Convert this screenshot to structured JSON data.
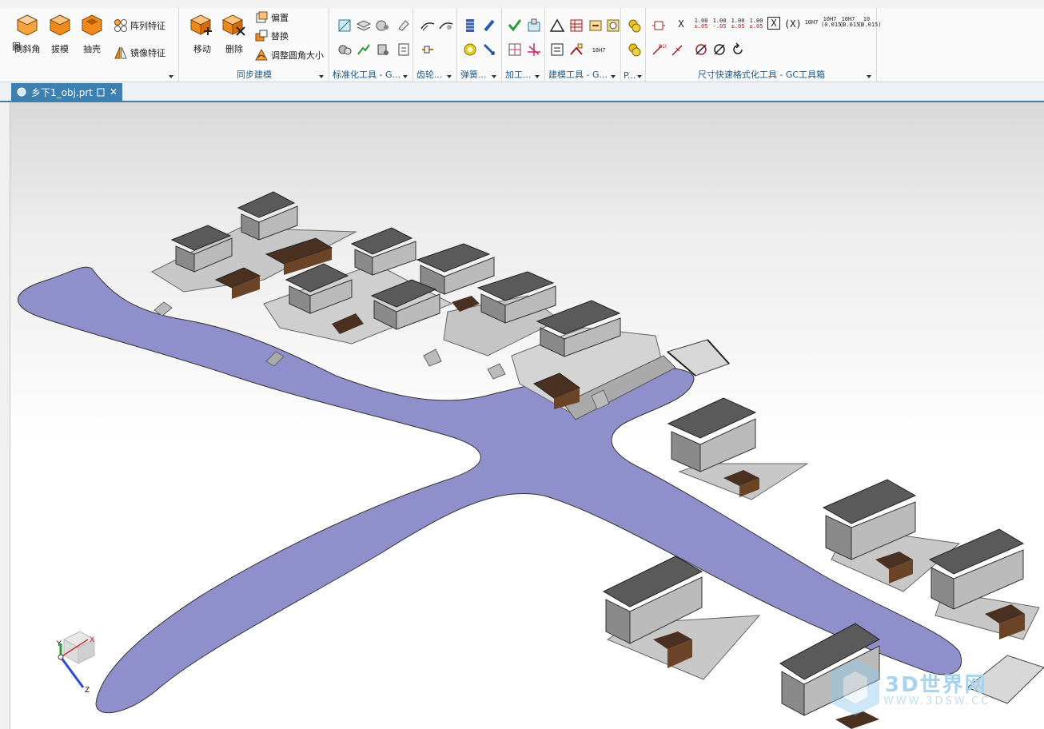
{
  "ribbon": {
    "cut_left_label": "图",
    "chamfer_label": "倒斜角",
    "draft_label": "拔模",
    "shell_label": "抽壳",
    "pattern_label": "阵列特征",
    "mirror_label": "镜像特征",
    "move_label": "移动",
    "delete_label": "删除",
    "offset_label": "偏置",
    "replace_label": "替换",
    "resize_blend_label": "调整圆角大小",
    "sync_group": "同步建模",
    "std_tools_group": "标准化工具 - G...",
    "gear_group": "齿轮...",
    "spring_group": "弹簧...",
    "machining_group": "加工...",
    "modeling_tools_group": "建模工具 - G...",
    "p_group": "P...",
    "dim_format_group": "尺寸快速格式化工具 - GC工具箱",
    "dim_values": [
      "1.00",
      "1.00",
      "1.00",
      "1.00"
    ],
    "dim_tol": [
      "±.05",
      "-.05",
      "±.05",
      "±.05"
    ],
    "tol_10h7": [
      "10H7",
      "10H7",
      "10H7",
      "10"
    ],
    "tol_10h7_sub": [
      "",
      "(0.015)",
      "(0.015)",
      "(0.015)"
    ],
    "dim_x": "X",
    "dim_xparen": "(X)",
    "dim_10h7_small": "10H7"
  },
  "tabs": [
    {
      "label": "乡下1_obj.prt"
    }
  ],
  "viewport": {
    "background_top": "#d9d9d9",
    "river_color": "#8f8fcb",
    "axis_labels": {
      "x": "X",
      "y": "Y",
      "z": "Z"
    }
  },
  "watermark": {
    "text": "3D世界网",
    "url": "WWW.3DSW.CC"
  },
  "colors": {
    "accent": "#3c7fb1",
    "ribbon_label": "#1f5a8a",
    "orange_icon": "#f08a1d"
  }
}
